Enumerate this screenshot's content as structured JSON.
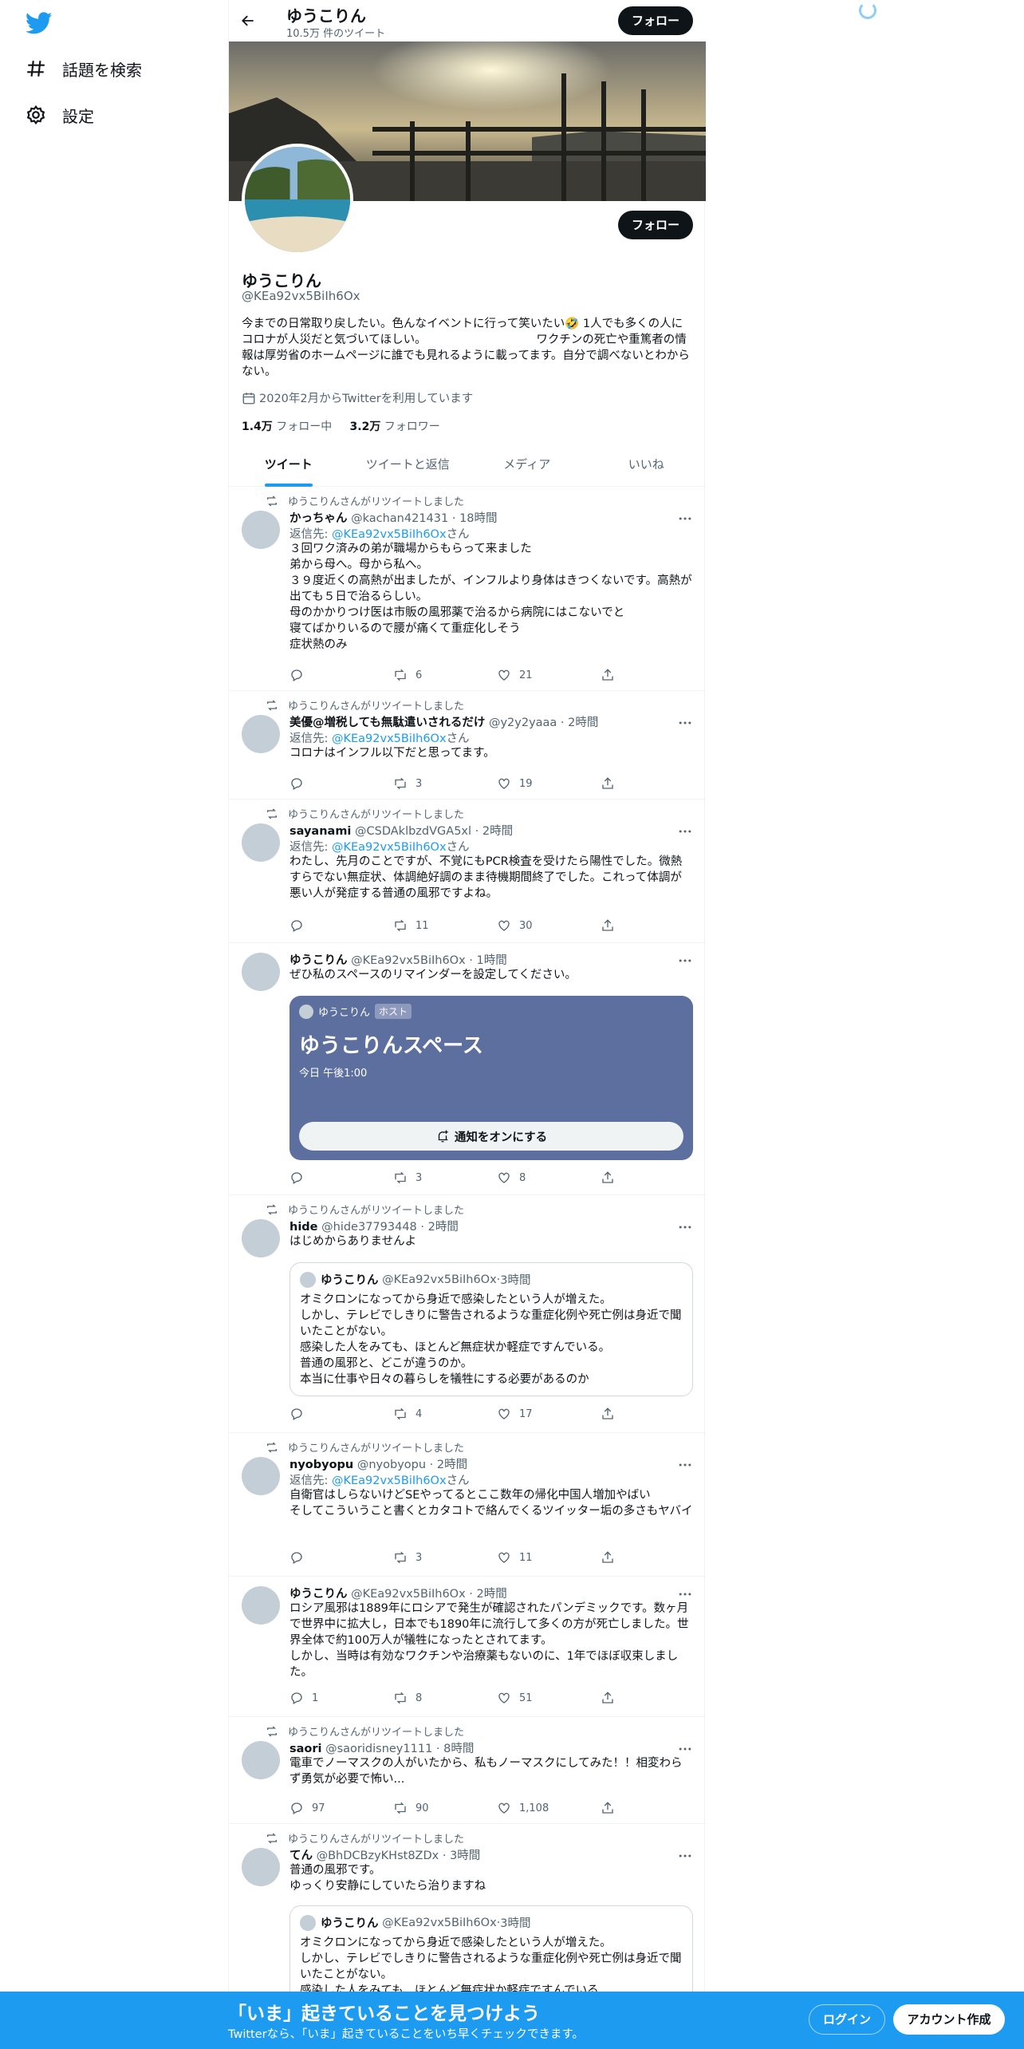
{
  "sidebar": {
    "logo_icon": "twitter-bird-icon",
    "items": [
      {
        "label": "話題を検索",
        "icon": "hashtag-icon"
      },
      {
        "label": "設定",
        "icon": "gear-icon"
      }
    ]
  },
  "header": {
    "name": "ゆうこりん",
    "tweet_count": "10.5万 件のツイート",
    "follow_label": "フォロー"
  },
  "profile": {
    "name": "ゆうこりん",
    "handle": "@KEa92vx5BiIh6Ox",
    "follow_label": "フォロー",
    "bio": "今までの日常取り戻したい。色んなイベントに行って笑いたい🤣 1人でも多くの人にコロナが人災だと気づいてほしい。　　　　　　　　　　ワクチンの死亡や重篤者の情報は厚労省のホームページに誰でも見れるように載ってます。自分で調べないとわからない。",
    "joined": "2020年2月からTwitterを利用しています",
    "following_count": "1.4万",
    "following_label": "フォロー中",
    "followers_count": "3.2万",
    "followers_label": "フォロワー"
  },
  "tabs": [
    "ツイート",
    "ツイートと返信",
    "メディア",
    "いいね"
  ],
  "tweets": [
    {
      "rt": "ゆうこりんさんがリツイートしました",
      "name": "かっちゃん",
      "handle": "@kachan421431",
      "time": "18時間",
      "reply_prefix": "返信先: ",
      "reply_to": "@KEa92vx5BiIh6Ox",
      "reply_suffix": "さん",
      "text": "３回ワク済みの弟が職場からもらって来ました\n弟から母へ。母から私へ。\n３９度近くの高熱が出ましたが、インフルより身体はきつくないです。高熱が出ても５日で治るらしい。\n母のかかりつけ医は市販の風邪薬で治るから病院にはこないでと\n寝てばかりいるので腰が痛くて重症化しそう\n症状熱のみ",
      "replies": "",
      "retweets": "6",
      "likes": "21"
    },
    {
      "rt": "ゆうこりんさんがリツイートしました",
      "name": "美優@増税しても無駄遣いされるだけ",
      "handle": "@y2y2yaaa",
      "time": "2時間",
      "reply_prefix": "返信先: ",
      "reply_to": "@KEa92vx5BiIh6Ox",
      "reply_suffix": "さん",
      "text": "コロナはインフル以下だと思ってます。",
      "replies": "",
      "retweets": "3",
      "likes": "19"
    },
    {
      "rt": "ゆうこりんさんがリツイートしました",
      "name": "sayanami",
      "handle": "@CSDAklbzdVGA5xl",
      "time": "2時間",
      "reply_prefix": "返信先: ",
      "reply_to": "@KEa92vx5BiIh6Ox",
      "reply_suffix": "さん",
      "text": "わたし、先月のことですが、不覚にもPCR検査を受けたら陽性でした。微熱すらでない無症状、体調絶好調のまま待機期間終了でした。これって体調が悪い人が発症する普通の風邪ですよね。",
      "replies": "",
      "retweets": "11",
      "likes": "30"
    },
    {
      "name": "ゆうこりん",
      "handle": "@KEa92vx5BiIh6Ox",
      "time": "1時間",
      "text": "ぜひ私のスペースのリマインダーを設定してください。",
      "space": {
        "host_name": "ゆうこりん",
        "host_badge": "ホスト",
        "title": "ゆうこりんスペース",
        "time": "今日 午後1:00",
        "button": "通知をオンにする"
      },
      "replies": "",
      "retweets": "3",
      "likes": "8"
    },
    {
      "rt": "ゆうこりんさんがリツイートしました",
      "name": "hide",
      "handle": "@hide37793448",
      "time": "2時間",
      "text": "はじめからありませんよ",
      "quote": {
        "name": "ゆうこりん",
        "handle": "@KEa92vx5BiIh6Ox",
        "time": "3時間",
        "text": "オミクロンになってから身近で感染したという人が増えた。\nしかし、テレビでしきりに警告されるような重症化例や死亡例は身近で聞いたことがない。\n感染した人をみても、ほとんど無症状か軽症ですんでいる。\n普通の風邪と、どこが違うのか。\n本当に仕事や日々の暮らしを犠牲にする必要があるのか"
      },
      "replies": "",
      "retweets": "4",
      "likes": "17"
    },
    {
      "rt": "ゆうこりんさんがリツイートしました",
      "name": "nyobyopu",
      "handle": "@nyobyopu",
      "time": "2時間",
      "reply_prefix": "返信先: ",
      "reply_to": "@KEa92vx5BiIh6Ox",
      "reply_suffix": "さん",
      "text": "自衛官はしらないけどSEやってるとここ数年の帰化中国人増加やばい\nそしてこういうこと書くとカタコトで絡んでくるツイッター垢の多さもヤバイ",
      "replies": "",
      "retweets": "3",
      "likes": "11"
    },
    {
      "name": "ゆうこりん",
      "handle": "@KEa92vx5BiIh6Ox",
      "time": "2時間",
      "text": "ロシア風邪は1889年にロシアで発生が確認されたパンデミックです。数ヶ月で世界中に拡大し，日本でも1890年に流行して多くの方が死亡しました。世界全体で約100万人が犠牲になったとされてます。\nしかし、当時は有効なワクチンや治療薬もないのに、1年でほぼ収束しました。",
      "replies": "1",
      "retweets": "8",
      "likes": "51"
    },
    {
      "rt": "ゆうこりんさんがリツイートしました",
      "name": "saori",
      "handle": "@saoridisney1111",
      "time": "8時間",
      "text": "電車でノーマスクの人がいたから、私もノーマスクにしてみた！！相変わらず勇気が必要で怖い...",
      "replies": "97",
      "retweets": "90",
      "likes": "1,108"
    },
    {
      "rt": "ゆうこりんさんがリツイートしました",
      "name": "てん",
      "handle": "@BhDCBzyKHst8ZDx",
      "time": "3時間",
      "text": "普通の風邪です。\nゆっくり安静にしていたら治りますね",
      "quote": {
        "name": "ゆうこりん",
        "handle": "@KEa92vx5BiIh6Ox",
        "time": "3時間",
        "text": "オミクロンになってから身近で感染したという人が増えた。\nしかし、テレビでしきりに警告されるような重症化例や死亡例は身近で聞いたことがない。\n感染した人をみても、ほとんど無症状か軽症ですんでいる"
      },
      "replies": "",
      "retweets": "",
      "likes": ""
    }
  ],
  "bottom_bar": {
    "title": "「いま」起きていることを見つけよう",
    "subtitle": "Twitterなら、「いま」起きていることをいち早くチェックできます。",
    "login": "ログイン",
    "signup": "アカウント作成"
  },
  "colors": {
    "accent": "#1d9bf0",
    "dark": "#0f1419",
    "muted": "#536471",
    "space_card": "#5c6f9f"
  }
}
